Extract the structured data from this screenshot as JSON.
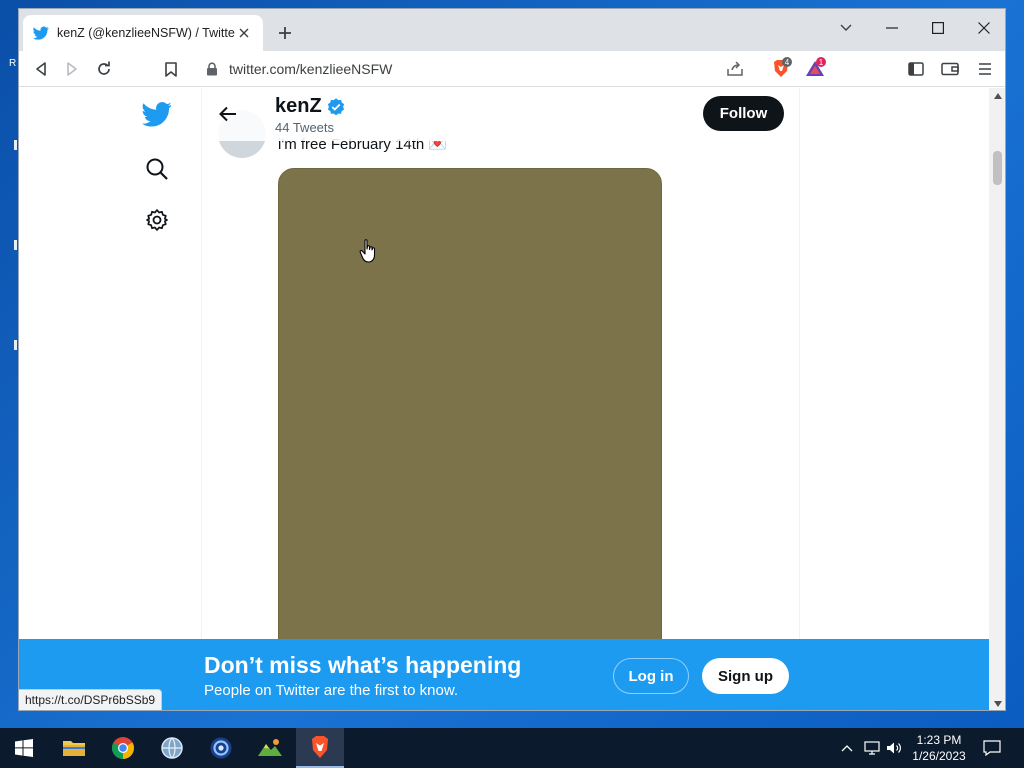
{
  "browser": {
    "tab_title": "kenZ (@kenzlieeNSFW) / Twitter",
    "url": "twitter.com/kenzlieeNSFW",
    "brave_shield_badge": "4",
    "rewards_badge": "1",
    "status_url": "https://t.co/DSPr6bSSb9"
  },
  "profile": {
    "name": "kenZ",
    "tweet_count": "44 Tweets",
    "follow_label": "Follow"
  },
  "tweet": {
    "text": "i'm free February 14th",
    "emoji": "💌"
  },
  "banner": {
    "title": "Don’t miss what’s happening",
    "subtitle": "People on Twitter are the first to know.",
    "login_label": "Log in",
    "signup_label": "Sign up"
  },
  "taskbar": {
    "time": "1:23 PM",
    "date": "1/26/2023"
  },
  "desktop": {
    "edge_char": "R"
  },
  "colors": {
    "twitter_blue": "#1d9bf0",
    "media_placeholder": "#7c734a",
    "follow_button": "#0f1419"
  }
}
